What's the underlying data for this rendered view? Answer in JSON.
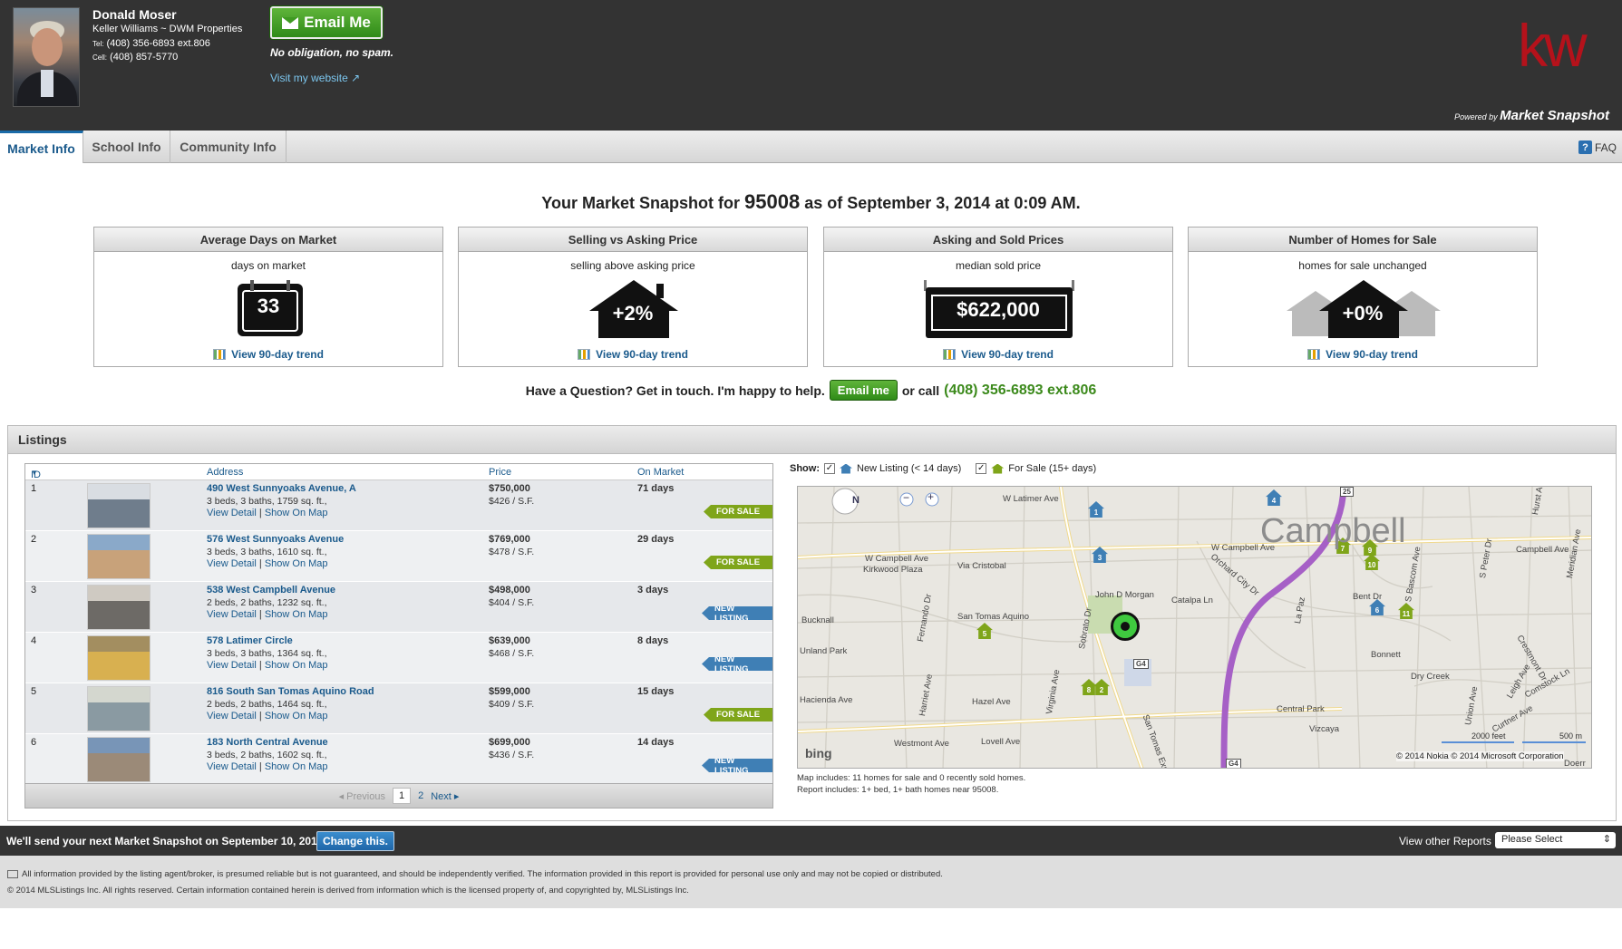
{
  "agent": {
    "name": "Donald Moser",
    "company": "Keller Williams ~ DWM Properties",
    "tel_label": "Tel:",
    "tel": "(408) 356-6893 ext.806",
    "cell_label": "Cell:",
    "cell": "(408) 857-5770",
    "email_button": "Email Me",
    "no_spam": "No obligation, no spam.",
    "website_link": "Visit my website"
  },
  "brand": {
    "logo_text": "kw",
    "powered_by": "Powered by",
    "powered_name": "Market Snapshot",
    "accent_color": "#b5121b"
  },
  "tabs": [
    {
      "label": "Market Info",
      "active": true
    },
    {
      "label": "School Info",
      "active": false
    },
    {
      "label": "Community Info",
      "active": false
    }
  ],
  "faq_label": "FAQ",
  "snapshot": {
    "title_prefix": "Your Market Snapshot for",
    "zip": "95008",
    "title_suffix": "as of September 3, 2014 at 0:09 AM.",
    "trend_link": "View 90-day trend",
    "cards": [
      {
        "title": "Average Days on Market",
        "subtitle": "days on market",
        "value": "33",
        "icon": "calendar-icon"
      },
      {
        "title": "Selling vs Asking Price",
        "subtitle": "selling above asking price",
        "value": "+2%",
        "icon": "house-icon"
      },
      {
        "title": "Asking and Sold Prices",
        "subtitle": "median sold price",
        "value": "$622,000",
        "icon": "price-sign-icon"
      },
      {
        "title": "Number of Homes for Sale",
        "subtitle": "homes for sale unchanged",
        "value": "+0%",
        "icon": "houses-icon"
      }
    ]
  },
  "question": {
    "text": "Have a Question? Get in touch. I'm happy to help.",
    "button": "Email me",
    "or_call": "or call",
    "phone": "(408) 356-6893 ext.806"
  },
  "listings": {
    "heading": "Listings",
    "columns": {
      "id": "ID",
      "address": "Address",
      "price": "Price",
      "on_market": "On Market"
    },
    "view_detail": "View Detail",
    "show_on_map": "Show On Map",
    "rows": [
      {
        "id": "1",
        "address": "490 West Sunnyoaks Avenue, A",
        "details": "3 beds, 3 baths, 1759 sq. ft.,",
        "price": "$750,000",
        "psf": "$426 / S.F.",
        "days": "71 days",
        "status": "FOR SALE"
      },
      {
        "id": "2",
        "address": "576 West Sunnyoaks Avenue",
        "details": "3 beds, 3 baths, 1610 sq. ft.,",
        "price": "$769,000",
        "psf": "$478 / S.F.",
        "days": "29 days",
        "status": "FOR SALE"
      },
      {
        "id": "3",
        "address": "538 West Campbell Avenue",
        "details": "2 beds, 2 baths, 1232 sq. ft.,",
        "price": "$498,000",
        "psf": "$404 / S.F.",
        "days": "3 days",
        "status": "NEW LISTING"
      },
      {
        "id": "4",
        "address": "578 Latimer Circle",
        "details": "3 beds, 3 baths, 1364 sq. ft.,",
        "price": "$639,000",
        "psf": "$468 / S.F.",
        "days": "8 days",
        "status": "NEW LISTING"
      },
      {
        "id": "5",
        "address": "816 South San Tomas Aquino Road",
        "details": "2 beds, 2 baths, 1464 sq. ft.,",
        "price": "$599,000",
        "psf": "$409 / S.F.",
        "days": "15 days",
        "status": "FOR SALE"
      },
      {
        "id": "6",
        "address": "183 North Central Avenue",
        "details": "3 beds, 2 baths, 1602 sq. ft.,",
        "price": "$699,000",
        "psf": "$436 / S.F.",
        "days": "14 days",
        "status": "NEW LISTING"
      }
    ],
    "pager": {
      "previous": "Previous",
      "page1": "1",
      "page2": "2",
      "next": "Next"
    }
  },
  "map": {
    "show_label": "Show:",
    "filter_new": "New Listing (< 14 days)",
    "filter_sale": "For Sale (15+ days)",
    "city_label": "Campbell",
    "streets": [
      "W Latimer Ave",
      "W Campbell Ave",
      "W Campbell Ave",
      "Via Cristobal",
      "Kirkwood Plaza",
      "Campbell Ave",
      "Orchard City Dr",
      "Catalpa Ln",
      "John D Morgan",
      "San Tomas Aquino",
      "Bucknall",
      "Unland Park",
      "Hacienda Ave",
      "Westmont Ave",
      "Lovell Ave",
      "Hazel Ave",
      "Virginia Ave",
      "Harriet Ave",
      "Fernando Dr",
      "Sobrato Dr",
      "San Tomas Expy",
      "Bent Dr",
      "Bonnett",
      "Dry Creek",
      "Central Park",
      "Vizcaya",
      "Curtner Ave",
      "Union Ave",
      "La Paz",
      "S Bascom Ave",
      "Hurst Ave",
      "Meridian Ave",
      "Leigh Ave",
      "Crestmont Dr",
      "Comstock Ln",
      "S Peter Dr",
      "Doerr"
    ],
    "road_badges": [
      "G4",
      "G4",
      "25"
    ],
    "markers": [
      "1",
      "2",
      "3",
      "4",
      "5",
      "6",
      "7",
      "8",
      "9",
      "10",
      "11"
    ],
    "zoom_compass": "N",
    "scale_feet": "2000 feet",
    "scale_m": "500 m",
    "bing_logo": "bing",
    "copyright": "© 2014 Nokia  © 2014 Microsoft Corporation",
    "note1": "Map includes: 11 homes for sale and 0 recently sold homes.",
    "note2": "Report includes: 1+ bed, 1+ bath homes near 95008."
  },
  "footer": {
    "next_snapshot": "We'll send your next Market Snapshot on September 10, 2014.",
    "change_button": "Change this.",
    "view_other": "View other Reports",
    "select_value": "Please Select",
    "disclaimer1": "All information provided by the listing agent/broker, is presumed reliable but is not guaranteed, and should be independently verified. The information provided in this report is provided for personal use only and may not be copied or distributed.",
    "disclaimer2": "© 2014 MLSListings Inc. All rights reserved. Certain information contained herein is derived from information which is the licensed property of, and copyrighted by, MLSListings Inc."
  },
  "colors": {
    "new_listing": "#3f7fb5",
    "for_sale": "#7fa51a",
    "link": "#1a5a8c",
    "green_button": "#3f9a22"
  }
}
